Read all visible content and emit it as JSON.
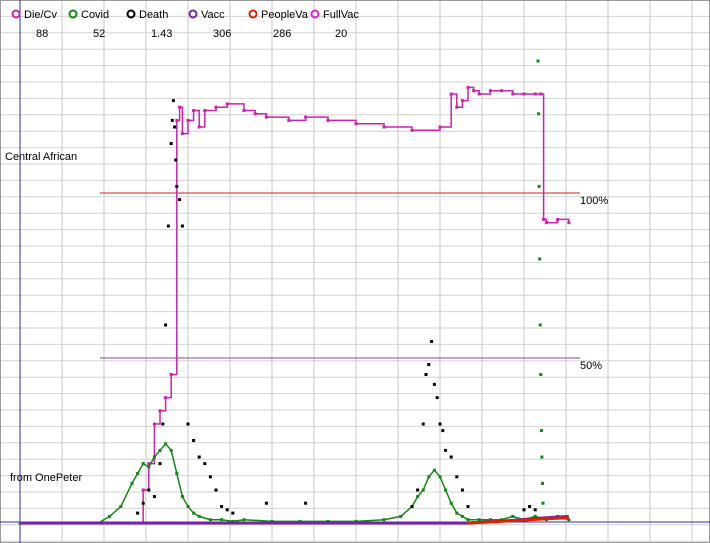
{
  "chart_data": {
    "type": "line",
    "title": "",
    "xlabel": "",
    "ylabel": "",
    "grid": true,
    "legend_placement": "top-left",
    "side_labels": {
      "region": "Central African",
      "source": "from OnePeter"
    },
    "reference_lines": [
      {
        "label": "100%",
        "value": 100,
        "color": "#cc2222"
      },
      {
        "label": "50%",
        "value": 50,
        "color": "#884499"
      }
    ],
    "y_range": [
      0,
      140
    ],
    "x_range": [
      0,
      100
    ],
    "legend": [
      {
        "name": "Die/Cv",
        "value": "88",
        "color": "#cc22aa"
      },
      {
        "name": "Covid",
        "value": "52",
        "color": "#118811"
      },
      {
        "name": "Death",
        "value": "1.43",
        "color": "#000000"
      },
      {
        "name": "Vacc",
        "value": "306",
        "color": "#7722aa"
      },
      {
        "name": "PeopleVa",
        "value": "286",
        "color": "#dd2200"
      },
      {
        "name": "FullVac",
        "value": "20",
        "color": "#dd22cc"
      }
    ],
    "series": [
      {
        "name": "Die/Cv",
        "style": "step-line",
        "color": "#cc22aa",
        "x": [
          0,
          14,
          22,
          23,
          24,
          25,
          26,
          27,
          28,
          28.5,
          29,
          30,
          31,
          32,
          33,
          35,
          37,
          40,
          42,
          44,
          48,
          51,
          55,
          60,
          65,
          70,
          75,
          77,
          78,
          79,
          80,
          81,
          82,
          84,
          86,
          88,
          90,
          92,
          93,
          93.5,
          94,
          96,
          98
        ],
        "y": [
          0,
          0,
          10,
          18,
          30,
          34,
          38,
          45,
          122,
          126,
          118,
          122,
          125,
          120,
          125,
          126,
          127,
          125,
          124,
          123,
          122,
          123,
          122,
          121,
          120,
          119,
          120,
          130,
          126,
          128,
          132,
          131,
          130,
          131,
          131,
          130,
          130,
          130,
          130,
          92,
          91,
          92,
          91
        ]
      },
      {
        "name": "Covid",
        "style": "marker-line",
        "color": "#118811",
        "x": [
          0,
          14,
          16,
          18,
          20,
          21,
          22,
          23,
          24,
          25,
          26,
          27,
          28,
          29,
          30,
          31,
          32,
          34,
          36,
          38,
          40,
          45,
          50,
          55,
          60,
          65,
          68,
          70,
          71,
          72,
          73,
          74,
          75,
          76,
          77,
          78,
          79,
          80,
          82,
          84,
          86,
          88,
          90,
          92,
          94,
          96,
          98
        ],
        "y": [
          0,
          0,
          2,
          5,
          12,
          15,
          18,
          17,
          20,
          22,
          24,
          22,
          15,
          8,
          5,
          3,
          2,
          1,
          1,
          0.5,
          1,
          0.5,
          0.5,
          0.5,
          0.5,
          1,
          2,
          5,
          8,
          10,
          14,
          16,
          14,
          10,
          6,
          3,
          2,
          1,
          1,
          1,
          1,
          2,
          1,
          2,
          1,
          2,
          1
        ]
      },
      {
        "name": "Death",
        "style": "scatter",
        "color": "#000000",
        "x": [
          20,
          21,
          22,
          23,
          24,
          25,
          25.5,
          26,
          26.5,
          27,
          27.2,
          27.4,
          27.6,
          27.8,
          28,
          28.5,
          29,
          30,
          31,
          32,
          33,
          34,
          35,
          36,
          37,
          38,
          44,
          51,
          70,
          71,
          72,
          72.5,
          73,
          73.5,
          74,
          74.5,
          75,
          75.5,
          76,
          77,
          78,
          79,
          80,
          90,
          91,
          92
        ],
        "y": [
          0,
          3,
          6,
          10,
          8,
          18,
          30,
          60,
          90,
          115,
          122,
          128,
          120,
          110,
          102,
          98,
          90,
          30,
          25,
          20,
          18,
          14,
          10,
          5,
          4,
          3,
          6,
          6,
          5,
          10,
          30,
          45,
          48,
          55,
          42,
          38,
          30,
          28,
          22,
          20,
          14,
          10,
          5,
          4,
          5,
          4
        ]
      },
      {
        "name": "Vacc",
        "style": "line",
        "color": "#7722aa",
        "x": [
          0,
          80,
          85,
          88,
          91,
          94,
          98
        ],
        "y": [
          0,
          0,
          0.5,
          0.8,
          1.2,
          1.6,
          2
        ]
      },
      {
        "name": "PeopleVa",
        "style": "line",
        "color": "#dd2200",
        "x": [
          80,
          85,
          88,
          91,
          94,
          98
        ],
        "y": [
          0,
          0.4,
          0.7,
          1.0,
          1.3,
          1.6
        ]
      },
      {
        "name": "FullVac",
        "style": "scatter",
        "color": "#118811",
        "x": [
          92.5,
          92.6,
          92.7,
          92.8,
          92.9,
          93.0,
          93.1,
          93.2,
          93.3,
          93.4
        ],
        "y": [
          140,
          124,
          102,
          80,
          60,
          45,
          28,
          20,
          12,
          6
        ]
      }
    ]
  }
}
